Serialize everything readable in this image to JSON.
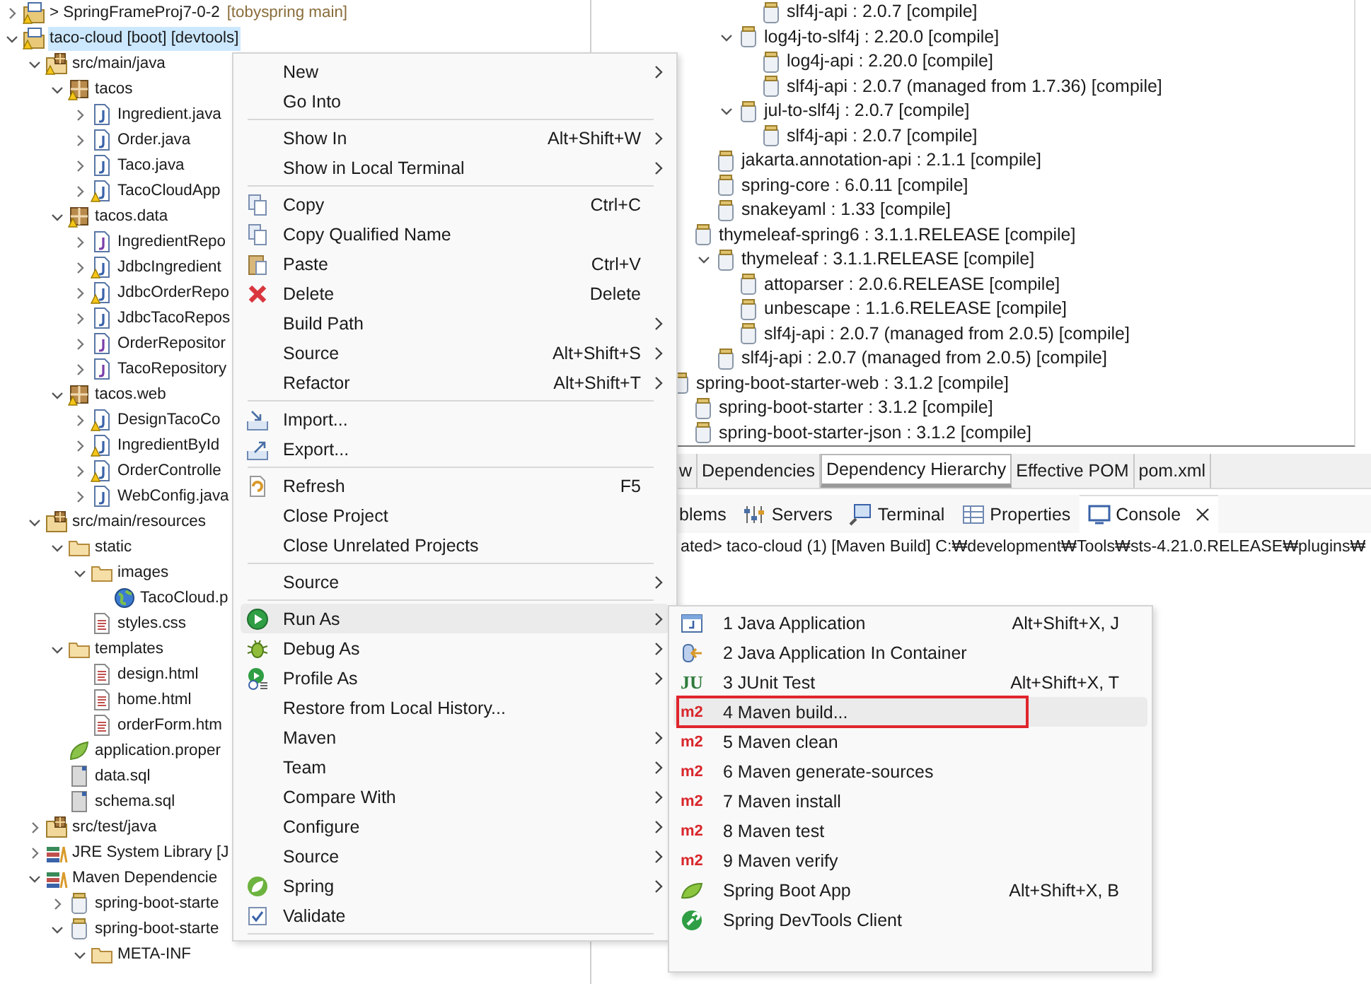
{
  "project_tree": {
    "items": [
      {
        "label": "> SpringFrameProj7-0-2",
        "suffix": "[tobyspring main]",
        "kind": "project",
        "expanded": false,
        "warning": true,
        "selected": false
      },
      {
        "label": "taco-cloud [boot] [devtools]",
        "kind": "project",
        "expanded": true,
        "warning": true,
        "selected": true,
        "children": [
          {
            "label": "src/main/java",
            "kind": "source-folder",
            "expanded": true,
            "warning": true,
            "selected": false,
            "children": [
              {
                "label": "tacos",
                "kind": "package",
                "expanded": true,
                "warning": true,
                "selected": false,
                "children": [
                  {
                    "label": "Ingredient.java",
                    "kind": "java",
                    "expanded": false,
                    "warning": false,
                    "selected": false
                  },
                  {
                    "label": "Order.java",
                    "kind": "java",
                    "expanded": false,
                    "warning": false,
                    "selected": false
                  },
                  {
                    "label": "Taco.java",
                    "kind": "java",
                    "expanded": false,
                    "warning": false,
                    "selected": false
                  },
                  {
                    "label": "TacoCloudApp",
                    "kind": "java",
                    "expanded": false,
                    "warning": true,
                    "selected": false
                  }
                ]
              },
              {
                "label": "tacos.data",
                "kind": "package",
                "expanded": true,
                "warning": true,
                "selected": false,
                "children": [
                  {
                    "label": "IngredientRepo",
                    "kind": "interface",
                    "expanded": false,
                    "warning": false,
                    "selected": false
                  },
                  {
                    "label": "JdbcIngredient",
                    "kind": "java",
                    "expanded": false,
                    "warning": true,
                    "selected": false
                  },
                  {
                    "label": "JdbcOrderRepo",
                    "kind": "java",
                    "expanded": false,
                    "warning": true,
                    "selected": false
                  },
                  {
                    "label": "JdbcTacoRepos",
                    "kind": "java",
                    "expanded": false,
                    "warning": false,
                    "selected": false
                  },
                  {
                    "label": "OrderRepositor",
                    "kind": "interface",
                    "expanded": false,
                    "warning": false,
                    "selected": false
                  },
                  {
                    "label": "TacoRepository",
                    "kind": "interface",
                    "expanded": false,
                    "warning": false,
                    "selected": false
                  }
                ]
              },
              {
                "label": "tacos.web",
                "kind": "package",
                "expanded": true,
                "warning": true,
                "selected": false,
                "children": [
                  {
                    "label": "DesignTacoCo",
                    "kind": "java",
                    "expanded": false,
                    "warning": true,
                    "selected": false
                  },
                  {
                    "label": "IngredientById",
                    "kind": "java",
                    "expanded": false,
                    "warning": true,
                    "selected": false
                  },
                  {
                    "label": "OrderControlle",
                    "kind": "java",
                    "expanded": false,
                    "warning": true,
                    "selected": false
                  },
                  {
                    "label": "WebConfig.java",
                    "kind": "java",
                    "expanded": false,
                    "warning": false,
                    "selected": false
                  }
                ]
              }
            ]
          },
          {
            "label": "src/main/resources",
            "kind": "source-folder",
            "expanded": true,
            "warning": false,
            "selected": false,
            "children": [
              {
                "label": "static",
                "kind": "folder",
                "expanded": true,
                "warning": false,
                "selected": false,
                "children": [
                  {
                    "label": "images",
                    "kind": "folder",
                    "expanded": true,
                    "warning": false,
                    "selected": false,
                    "children": [
                      {
                        "label": "TacoCloud.p",
                        "kind": "image",
                        "warning": false,
                        "selected": false
                      }
                    ]
                  },
                  {
                    "label": "styles.css",
                    "kind": "text",
                    "warning": false,
                    "selected": false
                  }
                ]
              },
              {
                "label": "templates",
                "kind": "folder",
                "expanded": true,
                "warning": false,
                "selected": false,
                "children": [
                  {
                    "label": "design.html",
                    "kind": "text",
                    "warning": false,
                    "selected": false
                  },
                  {
                    "label": "home.html",
                    "kind": "text",
                    "warning": false,
                    "selected": false
                  },
                  {
                    "label": "orderForm.htm",
                    "kind": "text",
                    "warning": false,
                    "selected": false
                  }
                ]
              },
              {
                "label": "application.proper",
                "kind": "properties",
                "warning": false,
                "selected": false
              },
              {
                "label": "data.sql",
                "kind": "sql",
                "warning": false,
                "selected": false
              },
              {
                "label": "schema.sql",
                "kind": "sql",
                "warning": false,
                "selected": false
              }
            ]
          },
          {
            "label": "src/test/java",
            "kind": "source-folder",
            "expanded": false,
            "warning": false,
            "selected": false
          },
          {
            "label": "JRE System Library [J",
            "kind": "library",
            "expanded": false,
            "warning": false,
            "selected": false
          },
          {
            "label": "Maven Dependencie",
            "kind": "library",
            "expanded": true,
            "warning": false,
            "selected": false,
            "children": [
              {
                "label": "spring-boot-starte",
                "kind": "jar",
                "expanded": false,
                "warning": false,
                "selected": false
              },
              {
                "label": "spring-boot-starte",
                "kind": "jar",
                "expanded": true,
                "warning": false,
                "selected": false,
                "children": [
                  {
                    "label": "META-INF",
                    "kind": "folder",
                    "expanded": true,
                    "warning": false,
                    "selected": false
                  }
                ]
              }
            ]
          }
        ]
      }
    ]
  },
  "dependency_tree": {
    "items": [
      {
        "children": [
          {
            "children": [
              {
                "children": [
                  {
                    "children": [
                      {
                        "label": "slf4j-api : 2.0.7 [compile]"
                      }
                    ]
                  },
                  {
                    "label": "log4j-to-slf4j : 2.20.0 [compile]",
                    "expanded": true,
                    "children": [
                      {
                        "label": "log4j-api : 2.20.0 [compile]"
                      },
                      {
                        "label": "slf4j-api : 2.0.7 (managed from 1.7.36) [compile]"
                      }
                    ]
                  },
                  {
                    "label": "jul-to-slf4j : 2.0.7 [compile]",
                    "expanded": true,
                    "children": [
                      {
                        "label": "slf4j-api : 2.0.7 [compile]"
                      }
                    ]
                  }
                ]
              },
              {
                "label": "jakarta.annotation-api : 2.1.1 [compile]"
              },
              {
                "label": "spring-core : 6.0.11 [compile]"
              },
              {
                "label": "snakeyaml : 1.33 [compile]"
              }
            ]
          },
          {
            "label": "thymeleaf-spring6 : 3.1.1.RELEASE [compile]",
            "children": [
              {
                "label": "thymeleaf : 3.1.1.RELEASE [compile]",
                "expanded": true,
                "children": [
                  {
                    "label": "attoparser : 2.0.6.RELEASE [compile]"
                  },
                  {
                    "label": "unbescape : 1.1.6.RELEASE [compile]"
                  },
                  {
                    "label": "slf4j-api : 2.0.7 (managed from 2.0.5) [compile]"
                  }
                ]
              },
              {
                "label": "slf4j-api : 2.0.7 (managed from 2.0.5) [compile]"
              }
            ]
          }
        ]
      },
      {
        "label": "spring-boot-starter-web : 3.1.2 [compile]",
        "children": [
          {
            "label": "spring-boot-starter : 3.1.2 [compile]"
          },
          {
            "label": "spring-boot-starter-json : 3.1.2 [compile]"
          }
        ]
      }
    ]
  },
  "editor_tabs": [
    {
      "label": "w",
      "selected": false
    },
    {
      "label": "Dependencies",
      "selected": false
    },
    {
      "label": "Dependency Hierarchy",
      "selected": true
    },
    {
      "label": "Effective POM",
      "selected": false
    },
    {
      "label": "pom.xml",
      "selected": false
    }
  ],
  "view_tabs": [
    {
      "label": "blems",
      "kind": "plain",
      "selected": false,
      "closable": false
    },
    {
      "label": "Servers",
      "kind": "servers",
      "selected": false,
      "closable": false
    },
    {
      "label": "Terminal",
      "kind": "terminal",
      "selected": false,
      "closable": false
    },
    {
      "label": "Properties",
      "kind": "properties",
      "selected": false,
      "closable": false
    },
    {
      "label": "Console",
      "kind": "console",
      "selected": true,
      "closable": true
    }
  ],
  "console": {
    "header": "ated> taco-cloud (1) [Maven Build] C:₩development₩Tools₩sts-4.21.0.RELEASE₩plugins₩"
  },
  "context_menu": {
    "items": [
      {
        "kind": "plain",
        "label": "New",
        "submenu": true,
        "selected": false
      },
      {
        "kind": "plain",
        "label": "Go Into",
        "selected": false
      },
      {
        "kind": "separator"
      },
      {
        "kind": "plain",
        "label": "Show In",
        "shortcut": "Alt+Shift+W",
        "submenu": true,
        "selected": false
      },
      {
        "kind": "plain",
        "label": "Show in Local Terminal",
        "submenu": true,
        "selected": false
      },
      {
        "kind": "separator"
      },
      {
        "kind": "copy",
        "label": "Copy",
        "shortcut": "Ctrl+C",
        "selected": false
      },
      {
        "kind": "copy",
        "label": "Copy Qualified Name",
        "selected": false
      },
      {
        "kind": "paste",
        "label": "Paste",
        "shortcut": "Ctrl+V",
        "selected": false
      },
      {
        "kind": "delete",
        "label": "Delete",
        "shortcut": "Delete",
        "selected": false
      },
      {
        "kind": "plain",
        "label": "Build Path",
        "submenu": true,
        "selected": false
      },
      {
        "kind": "plain",
        "label": "Source",
        "shortcut": "Alt+Shift+S",
        "submenu": true,
        "selected": false
      },
      {
        "kind": "plain",
        "label": "Refactor",
        "shortcut": "Alt+Shift+T",
        "submenu": true,
        "selected": false
      },
      {
        "kind": "separator"
      },
      {
        "kind": "import",
        "label": "Import...",
        "selected": false
      },
      {
        "kind": "export",
        "label": "Export...",
        "selected": false
      },
      {
        "kind": "separator"
      },
      {
        "kind": "refresh",
        "label": "Refresh",
        "shortcut": "F5",
        "selected": false
      },
      {
        "kind": "plain",
        "label": "Close Project",
        "selected": false
      },
      {
        "kind": "plain",
        "label": "Close Unrelated Projects",
        "selected": false
      },
      {
        "kind": "separator"
      },
      {
        "kind": "plain",
        "label": "Source",
        "submenu": true,
        "selected": false
      },
      {
        "kind": "separator"
      },
      {
        "kind": "run",
        "label": "Run As",
        "submenu": true,
        "selected": true
      },
      {
        "kind": "debug",
        "label": "Debug As",
        "submenu": true,
        "selected": false
      },
      {
        "kind": "profile",
        "label": "Profile As",
        "submenu": true,
        "selected": false
      },
      {
        "kind": "plain",
        "label": "Restore from Local History...",
        "selected": false
      },
      {
        "kind": "plain",
        "label": "Maven",
        "submenu": true,
        "selected": false
      },
      {
        "kind": "plain",
        "label": "Team",
        "submenu": true,
        "selected": false
      },
      {
        "kind": "plain",
        "label": "Compare With",
        "submenu": true,
        "selected": false
      },
      {
        "kind": "plain",
        "label": "Configure",
        "submenu": true,
        "selected": false
      },
      {
        "kind": "plain",
        "label": "Source",
        "submenu": true,
        "selected": false
      },
      {
        "kind": "spring",
        "label": "Spring",
        "submenu": true,
        "selected": false
      },
      {
        "kind": "validate",
        "label": "Validate",
        "selected": false
      },
      {
        "kind": "separator"
      }
    ]
  },
  "run_as_menu": {
    "items": [
      {
        "kind": "java-app",
        "label": "1 Java Application",
        "shortcut": "Alt+Shift+X, J",
        "selected": false,
        "annotated": false
      },
      {
        "kind": "container",
        "label": "2 Java Application In Container",
        "selected": false,
        "annotated": false
      },
      {
        "kind": "junit",
        "label": "3 JUnit Test",
        "shortcut": "Alt+Shift+X, T",
        "badge": "JU",
        "selected": false,
        "annotated": false
      },
      {
        "kind": "maven",
        "label": "4 Maven build...",
        "badge": "m2",
        "selected": true,
        "annotated": true
      },
      {
        "kind": "maven",
        "label": "5 Maven clean",
        "badge": "m2",
        "selected": false,
        "annotated": false
      },
      {
        "kind": "maven",
        "label": "6 Maven generate-sources",
        "badge": "m2",
        "selected": false,
        "annotated": false
      },
      {
        "kind": "maven",
        "label": "7 Maven install",
        "badge": "m2",
        "selected": false,
        "annotated": false
      },
      {
        "kind": "maven",
        "label": "8 Maven test",
        "badge": "m2",
        "selected": false,
        "annotated": false
      },
      {
        "kind": "maven",
        "label": "9 Maven verify",
        "badge": "m2",
        "selected": false,
        "annotated": false
      },
      {
        "kind": "spring",
        "label": "Spring Boot App",
        "shortcut": "Alt+Shift+X, B",
        "selected": false,
        "annotated": false
      },
      {
        "kind": "devtools",
        "label": "Spring DevTools Client",
        "selected": false,
        "annotated": false
      }
    ]
  }
}
